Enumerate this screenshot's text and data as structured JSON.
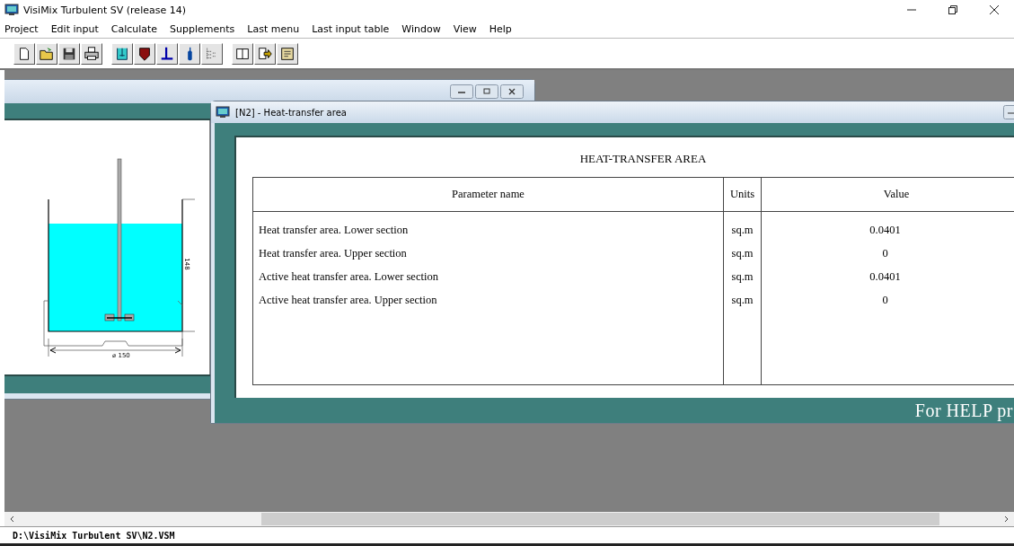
{
  "window": {
    "title": "VisiMix Turbulent SV (release 14)"
  },
  "menu": [
    "Project",
    "Edit input",
    "Calculate",
    "Supplements",
    "Last menu",
    "Last input table",
    "Window",
    "View",
    "Help"
  ],
  "vessel_window": {
    "height_label": "148",
    "diameter_label": "⌀ 150"
  },
  "result_window": {
    "title": "[N2] - Heat-transfer area",
    "heading": "HEAT-TRANSFER AREA",
    "columns": [
      "Parameter name",
      "Units",
      "Value"
    ],
    "rows": [
      {
        "name": "Heat transfer area. Lower section",
        "units": "sq.m",
        "value": "0.0401"
      },
      {
        "name": "Heat transfer area. Upper section",
        "units": "sq.m",
        "value": "0"
      },
      {
        "name": "Active heat transfer area. Lower section",
        "units": "sq.m",
        "value": "0.0401"
      },
      {
        "name": "Active heat transfer area. Upper section",
        "units": "sq.m",
        "value": "0"
      }
    ],
    "footer": "For HELP pr"
  },
  "status_bar": "D:\\VisiMix Turbulent SV\\N2.VSM"
}
